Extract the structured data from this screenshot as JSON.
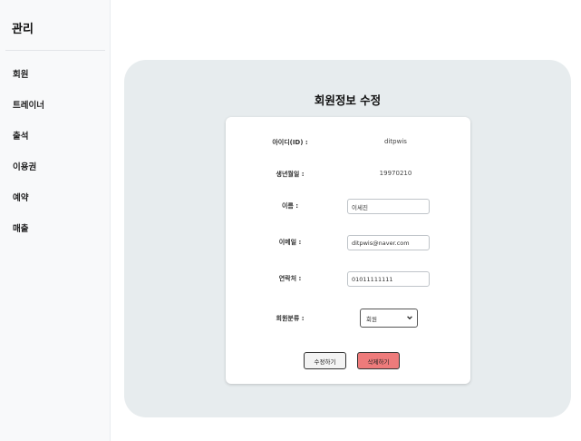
{
  "sidebar": {
    "title": "관리",
    "items": [
      {
        "label": "회원"
      },
      {
        "label": "트레이너"
      },
      {
        "label": "출석"
      },
      {
        "label": "이용권"
      },
      {
        "label": "예약"
      },
      {
        "label": "매출"
      }
    ]
  },
  "form": {
    "title": "회원정보 수정",
    "id_label": "아이디(ID) :",
    "id_value": "ditpwis",
    "birth_label": "생년월일 :",
    "birth_value": "19970210",
    "name_label": "이름 :",
    "name_value": "이세진",
    "email_label": "이메일 :",
    "email_value": "ditpwis@naver.com",
    "phone_label": "연락처 :",
    "phone_value": "01011111111",
    "category_label": "회원분류 :",
    "category_value": "회원"
  },
  "buttons": {
    "edit_label": "수정하기",
    "delete_label": "삭제하기"
  },
  "colors": {
    "panel_bg": "#e7ecee",
    "delete_button": "#ee7b7b",
    "sidebar_bg": "#f8f9fa"
  }
}
